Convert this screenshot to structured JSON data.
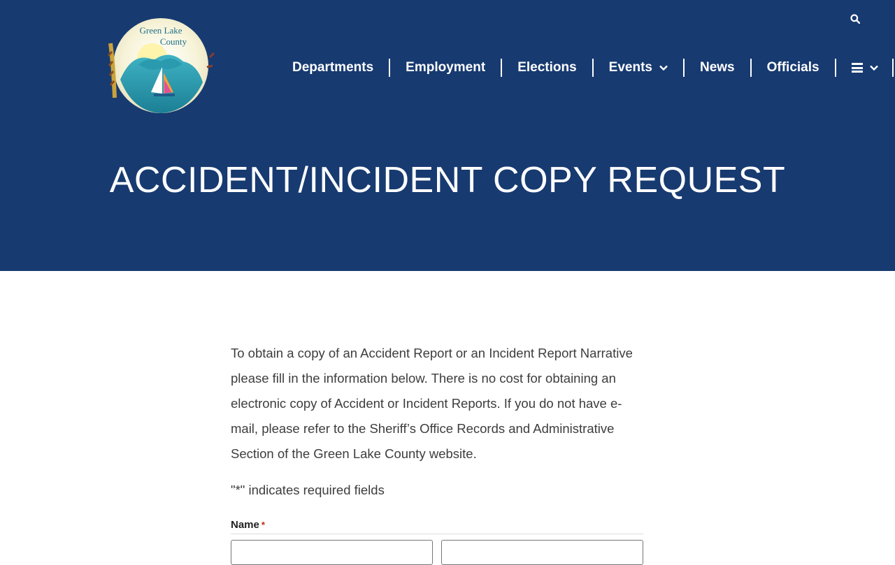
{
  "logo": {
    "line1": "Green Lake",
    "line2": "County"
  },
  "header": {
    "search_icon": "search-icon"
  },
  "nav": {
    "items": [
      {
        "label": "Departments"
      },
      {
        "label": "Employment"
      },
      {
        "label": "Elections"
      },
      {
        "label": "Events",
        "has_dropdown": true
      },
      {
        "label": "News"
      },
      {
        "label": "Officials"
      }
    ],
    "menu_icon": "hamburger-icon"
  },
  "page": {
    "title": "ACCIDENT/INCIDENT COPY REQUEST"
  },
  "content": {
    "intro": "To obtain a copy of an Accident Report or an Incident Report Narrative please fill in the information below. There is no cost for obtaining an electronic copy of Accident or Incident Reports. If you do not have e-mail, please refer to the Sheriff’s Office Records and Administrative Section of the Green Lake County website.",
    "required_note": "\"*\" indicates required fields"
  },
  "form": {
    "name_label": "Name",
    "required_mark": "*",
    "first_value": "",
    "last_value": ""
  },
  "colors": {
    "header_bg": "#173a70",
    "required": "#c02b0a"
  }
}
